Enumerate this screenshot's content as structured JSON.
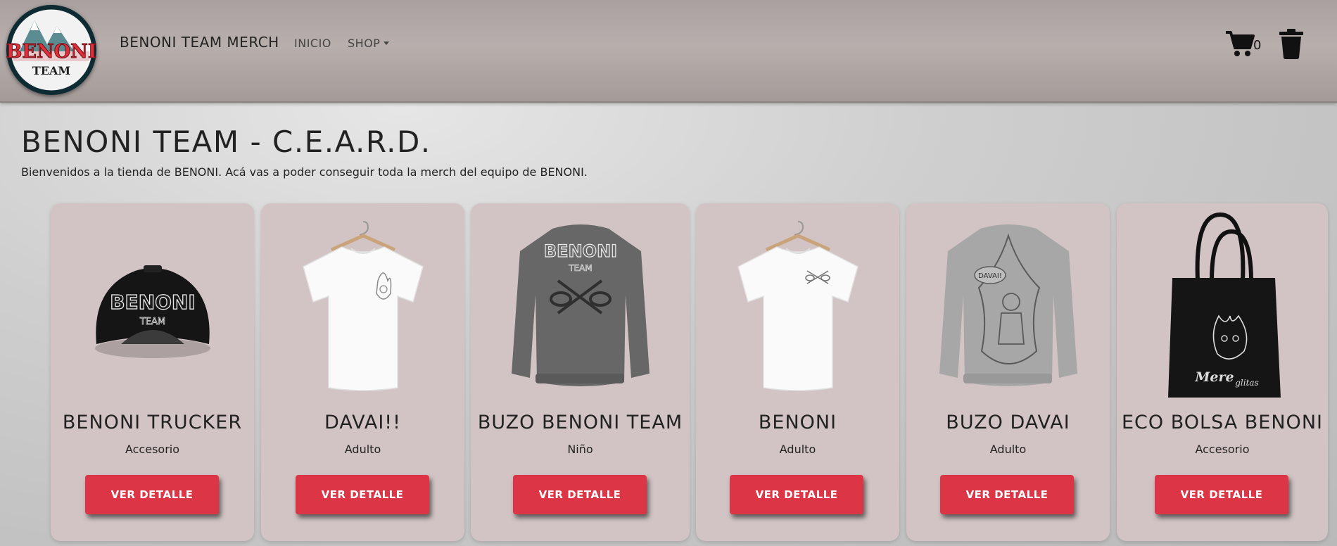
{
  "header": {
    "logo_text": "BENONI",
    "logo_subtext": "TEAM",
    "brand": "BENONI TEAM MERCH",
    "nav": [
      {
        "label": "INICIO"
      },
      {
        "label": "SHOP"
      }
    ],
    "cart_count": "0",
    "icons": [
      "cart-icon",
      "trash-icon"
    ]
  },
  "main": {
    "title": "BENONI TEAM - C.E.A.R.D.",
    "description": "Bienvenidos a la tienda de BENONI. Acá vas a poder conseguir toda la merch del equipo de BENONI."
  },
  "products": [
    {
      "name": "BENONI TRUCKER",
      "category": "Accesorio",
      "button": "VER DETALLE",
      "print": "BENONI",
      "print_sub": "TEAM"
    },
    {
      "name": "DAVAI!!",
      "category": "Adulto",
      "button": "VER DETALLE"
    },
    {
      "name": "BUZO BENONI TEAM",
      "category": "Niño",
      "button": "VER DETALLE",
      "print": "BENONI",
      "print_sub": "TEAM"
    },
    {
      "name": "BENONI",
      "category": "Adulto",
      "button": "VER DETALLE"
    },
    {
      "name": "BUZO DAVAI",
      "category": "Adulto",
      "button": "VER DETALLE",
      "print": "DAVAI!"
    },
    {
      "name": "ECO BOLSA BENONI",
      "category": "Accesorio",
      "button": "VER DETALLE",
      "print": "Mere",
      "print_sub": "glitas"
    }
  ],
  "colors": {
    "accent": "#dc3545",
    "card_bg": "#d2c4c4",
    "navbar_bg": "#b0a7a5",
    "logo_red": "#e0303a",
    "logo_navy": "#0e2b33"
  }
}
